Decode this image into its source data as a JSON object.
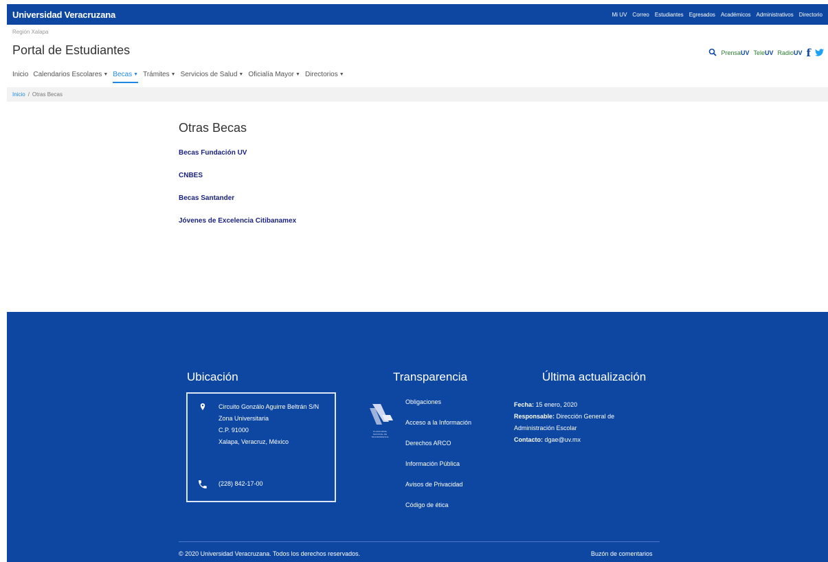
{
  "topbar": {
    "brand": "Universidad Veracruzana",
    "links": [
      "Mi UV",
      "Correo",
      "Estudiantes",
      "Egresados",
      "Académicos",
      "Administrativos",
      "Directorio"
    ]
  },
  "header": {
    "region": "Región Xalapa",
    "portal_title": "Portal de Estudiantes",
    "media": [
      {
        "prefix": "Prensa",
        "suffix": "UV"
      },
      {
        "prefix": "Tele",
        "suffix": "UV"
      },
      {
        "prefix": "Radio",
        "suffix": "UV"
      }
    ],
    "facebook": "f"
  },
  "nav": {
    "items": [
      {
        "label": "Inicio",
        "dropdown": false,
        "active": false
      },
      {
        "label": "Calendarios Escolares",
        "dropdown": true,
        "active": false
      },
      {
        "label": "Becas",
        "dropdown": true,
        "active": true
      },
      {
        "label": "Trámites",
        "dropdown": true,
        "active": false
      },
      {
        "label": "Servicios de Salud",
        "dropdown": true,
        "active": false
      },
      {
        "label": "Oficialía Mayor",
        "dropdown": true,
        "active": false
      },
      {
        "label": "Directorios",
        "dropdown": true,
        "active": false
      }
    ]
  },
  "breadcrumb": {
    "home": "Inicio",
    "separator": "/",
    "current": "Otras Becas"
  },
  "main": {
    "title": "Otras Becas",
    "links": [
      "Becas Fundación UV",
      "CNBES",
      "Becas Santander",
      "Jóvenes de Excelencia Citibanamex"
    ]
  },
  "footer": {
    "ubicacion": {
      "title": "Ubicación",
      "address": [
        "Circuito Gonzálo Aguirre Beltrán S/N",
        "Zona Universitaria",
        "C.P. 91000",
        "Xalapa, Veracruz, México"
      ],
      "phone": "(228) 842-17-00"
    },
    "transparencia": {
      "title": "Transparencia",
      "logo_text": [
        "PLATAFORMA",
        "NACIONAL DE",
        "TRANSPARENCIA"
      ],
      "links": [
        "Obligaciones",
        "Acceso a la Información",
        "Derechos ARCO",
        "Información Pública",
        "Avisos de Privacidad",
        "Código de ética"
      ]
    },
    "ultima": {
      "title": "Última actualización",
      "fecha_label": "Fecha:",
      "fecha": "15 enero, 2020",
      "responsable_label": "Responsable:",
      "responsable": "Dirección General de Administración Escolar",
      "contacto_label": "Contacto:",
      "contacto": "dgae@uv.mx"
    },
    "copyright": "© 2020 Universidad Veracruzana. Todos los derechos reservados.",
    "buzon": "Buzón de comentarios"
  },
  "colors": {
    "brand_blue": "#0d47a1",
    "active_link": "#1e88e5",
    "media_green": "#2e7d32"
  }
}
